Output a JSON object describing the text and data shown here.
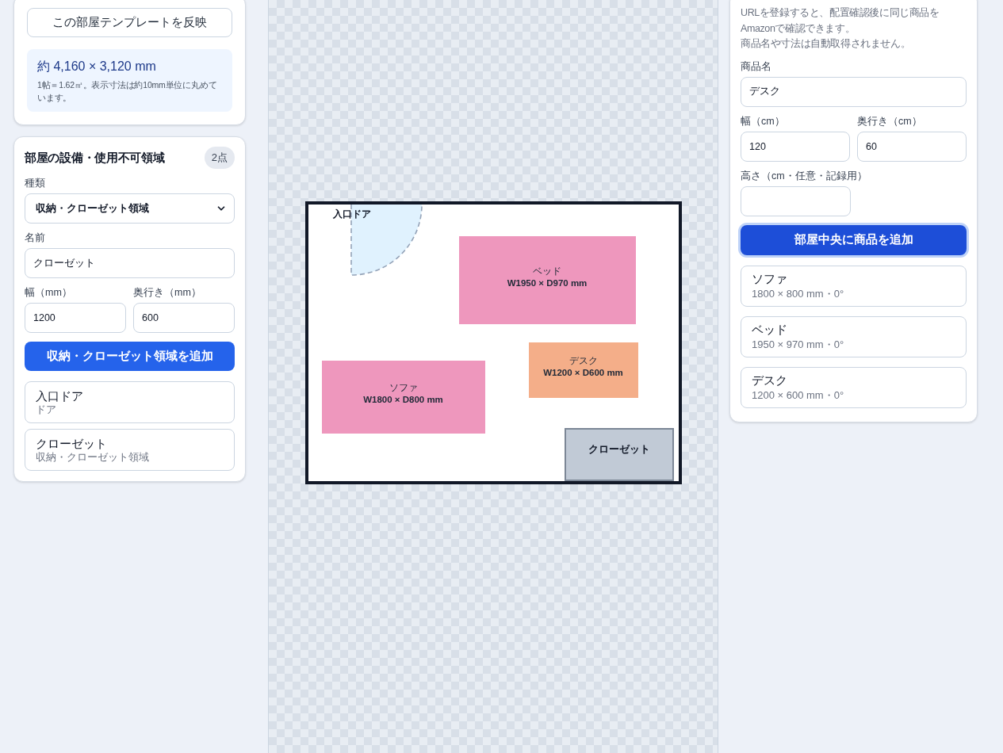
{
  "room_panel": {
    "template_button": "この部屋テンプレートを反映",
    "size_title": "約 4,160 × 3,120 mm",
    "size_note": "1帖＝1.62㎡。表示寸法は約10mm単位に丸めています。"
  },
  "fixtures_panel": {
    "title": "部屋の設備・使用不可領域",
    "count": "2点",
    "type_label": "種類",
    "type_value": "収納・クローゼット領域",
    "name_label": "名前",
    "name_value": "クローゼット",
    "width_label": "幅（mm）",
    "width_value": "1200",
    "depth_label": "奥行き（mm）",
    "depth_value": "600",
    "add_button": "収納・クローゼット領域を追加",
    "items": [
      {
        "name": "入口ドア",
        "type": "ドア"
      },
      {
        "name": "クローゼット",
        "type": "収納・クローゼット領域"
      }
    ]
  },
  "floor_plan": {
    "items": [
      {
        "kind": "door",
        "label": "入口ドア"
      },
      {
        "kind": "furniture",
        "name": "ベッド",
        "size": "W1950 × D970 mm",
        "color": "#ee97bd"
      },
      {
        "kind": "furniture",
        "name": "デスク",
        "size": "W1200 × D600 mm",
        "color": "#f4ae89"
      },
      {
        "kind": "furniture",
        "name": "ソファ",
        "size": "W1800 × D800 mm",
        "color": "#ee97bd"
      },
      {
        "kind": "closet",
        "label": "クローゼット"
      }
    ]
  },
  "product_panel": {
    "notes": [
      "URLを登録すると、配置確認後に同じ商品をAmazonで確認できます。",
      "商品名や寸法は自動取得されません。"
    ],
    "name_label": "商品名",
    "name_value": "デスク",
    "width_label": "幅（cm）",
    "width_value": "120",
    "depth_label": "奥行き（cm）",
    "depth_value": "60",
    "height_label": "高さ（cm・任意・記録用）",
    "add_button": {
      "label": "部屋中央に商品を追加",
      "focused": true
    },
    "products": [
      {
        "name": "ソファ",
        "detail": "1800 × 800 mm・0°"
      },
      {
        "name": "ベッド",
        "detail": "1950 × 970 mm・0°"
      },
      {
        "name": "デスク",
        "detail": "1200 × 600 mm・0°"
      }
    ]
  }
}
